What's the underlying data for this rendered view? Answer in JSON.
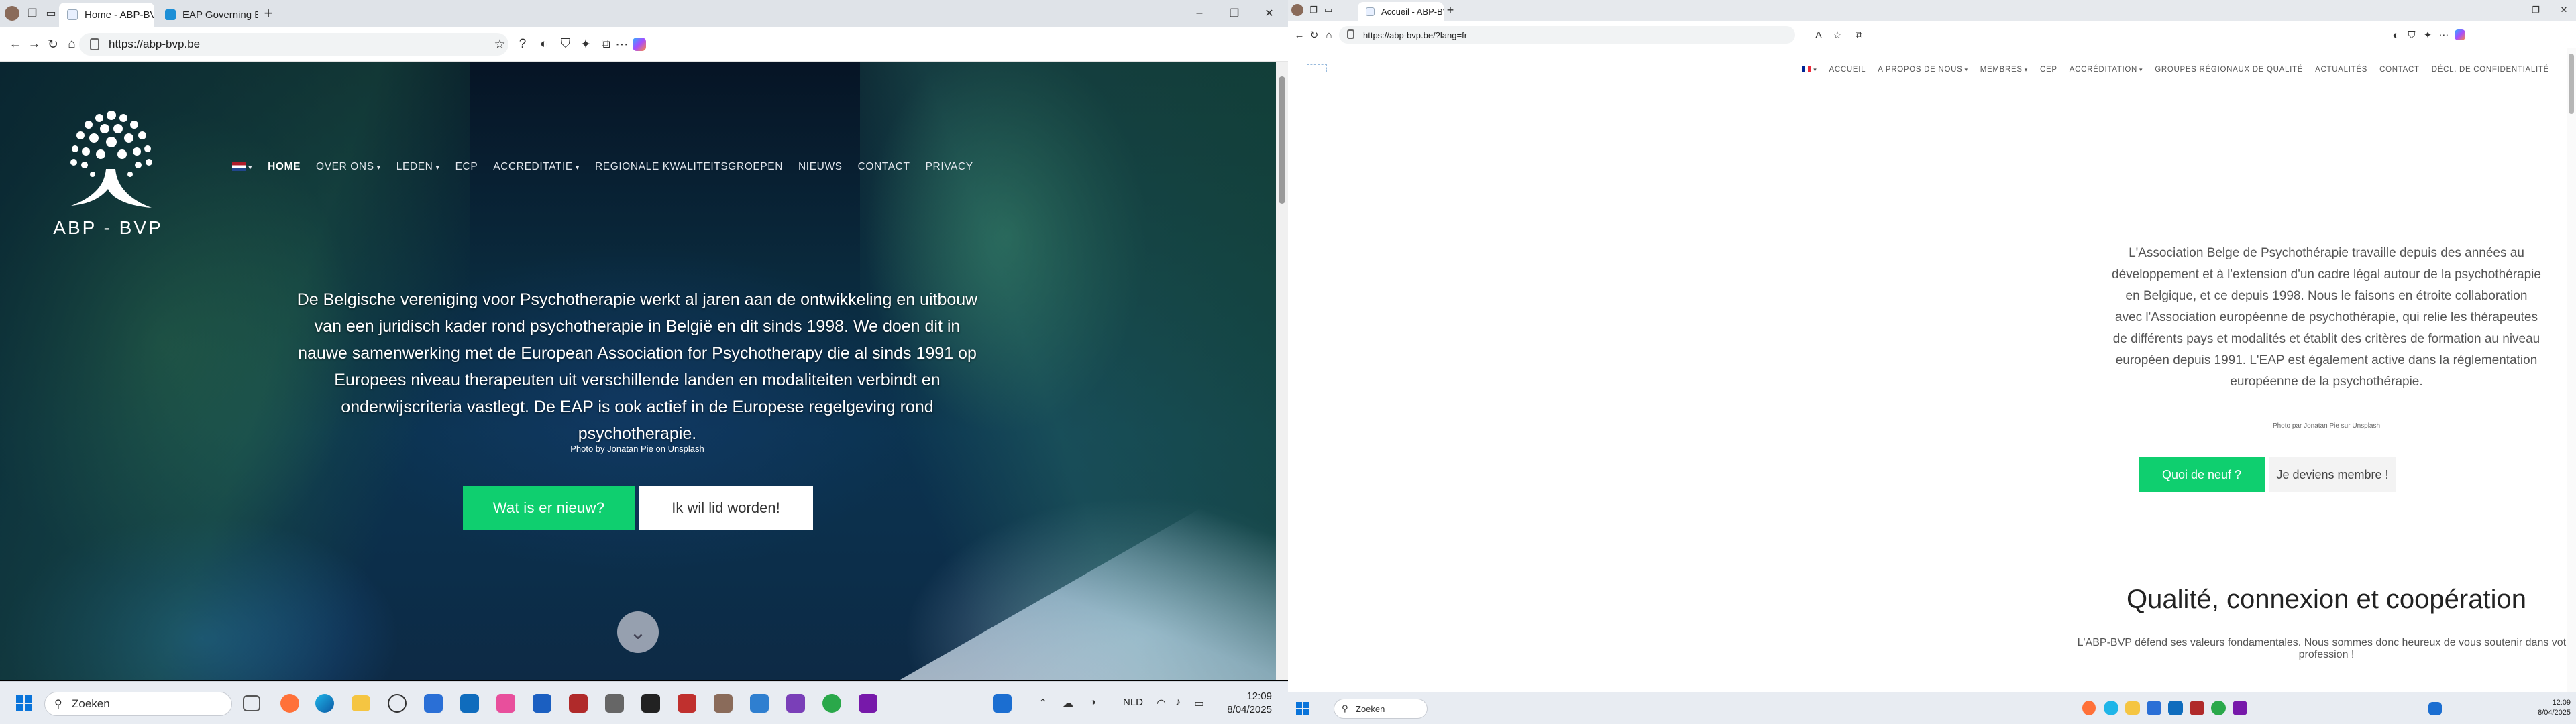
{
  "left_browser": {
    "tabs": [
      {
        "title": "Home - ABP-BVP",
        "active": true
      },
      {
        "title": "EAP Governing Board, AGM and C",
        "active": false
      }
    ],
    "url": "https://abp-bvp.be",
    "site": {
      "logo_text": "ABP - BVP",
      "nav": [
        "HOME",
        "OVER ONS",
        "LEDEN",
        "ECP",
        "ACCREDITATIE",
        "REGIONALE KWALITEITSGROEPEN",
        "NIEUWS",
        "CONTACT",
        "PRIVACY"
      ],
      "hero_text": "De Belgische vereniging voor Psychotherapie werkt al jaren aan de ontwikkeling en uitbouw van een juridisch kader rond psychotherapie in België en dit sinds 1998. We doen dit in nauwe samenwerking met de European Association for Psychotherapy die al sinds 1991 op Europees niveau therapeuten uit verschillende landen en modaliteiten verbindt en onderwijscriteria vastlegt. De EAP is ook actief in de Europese regelgeving rond psychotherapie.",
      "credit_prefix": "Photo by",
      "credit_author": "Jonatan Pie",
      "credit_on": "on",
      "credit_site": "Unsplash",
      "btn_news": "Wat is er nieuw?",
      "btn_join": "Ik wil lid worden!"
    },
    "taskbar": {
      "search": "Zoeken",
      "lang": "NLD",
      "time": "12:09",
      "date": "8/04/2025"
    }
  },
  "right_browser": {
    "tabs": [
      {
        "title": "Accueil - ABP-BVP",
        "active": true
      }
    ],
    "url": "https://abp-bvp.be/?lang=fr",
    "site": {
      "nav": [
        "ACCUEIL",
        "A PROPOS DE NOUS",
        "MEMBRES",
        "CEP",
        "ACCRÉDITATION",
        "GROUPES RÉGIONAUX DE QUALITÉ",
        "ACTUALITÉS",
        "CONTACT",
        "DÉCL. DE CONFIDENTIALITÉ"
      ],
      "hero_text": "L'Association Belge de Psychothérapie travaille depuis des années au développement et à l'extension d'un cadre légal autour de la psychothérapie en Belgique, et ce depuis 1998. Nous le faisons en étroite collaboration avec l'Association européenne de psychothérapie, qui relie les thérapeutes de différents pays et modalités et établit des critères de formation au niveau européen depuis 1991. L'EAP est également active dans la réglementation européenne de la psychothérapie.",
      "credit": "Photo par Jonatan Pie sur Unsplash",
      "btn_news": "Quoi de neuf ?",
      "btn_join": "Je deviens membre !",
      "heading": "Qualité, connexion et coopération",
      "subheading": "L'ABP-BVP défend ses valeurs fondamentales. Nous sommes donc heureux de vous soutenir dans votre profession !"
    },
    "taskbar": {
      "search": "Zoeken",
      "time": "12:09",
      "date": "8/04/2025"
    }
  },
  "colors": {
    "accent_green": "#0fcf6f",
    "windows_blue": "#0a74da"
  }
}
